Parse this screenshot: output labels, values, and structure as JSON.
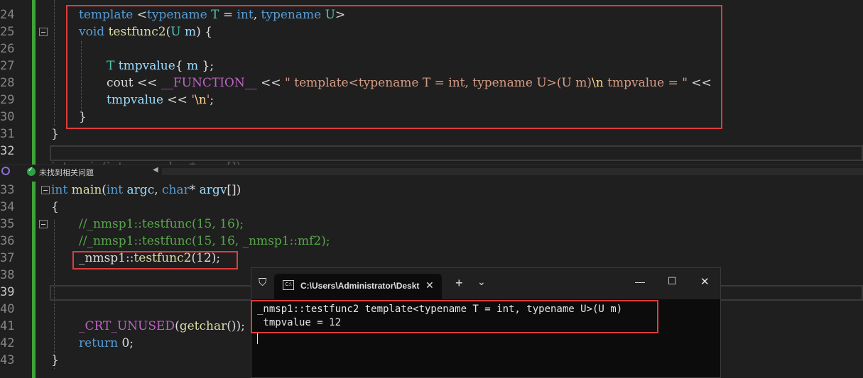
{
  "top_pane": {
    "line_numbers": [
      "24",
      "25",
      "26",
      "27",
      "28",
      "29",
      "30",
      "31",
      "32"
    ],
    "lines": [
      {
        "parts": [
          {
            "c": "kw",
            "t": "template"
          },
          {
            "c": "plain",
            "t": " <"
          },
          {
            "c": "kw",
            "t": "typename"
          },
          {
            "c": "plain",
            "t": " "
          },
          {
            "c": "ty",
            "t": "T"
          },
          {
            "c": "plain",
            "t": " = "
          },
          {
            "c": "kw",
            "t": "int"
          },
          {
            "c": "plain",
            "t": ", "
          },
          {
            "c": "kw",
            "t": "typename"
          },
          {
            "c": "plain",
            "t": " "
          },
          {
            "c": "ty",
            "t": "U"
          },
          {
            "c": "plain",
            "t": ">"
          }
        ]
      },
      {
        "parts": [
          {
            "c": "kw",
            "t": "void"
          },
          {
            "c": "plain",
            "t": " "
          },
          {
            "c": "fn",
            "t": "testfunc2"
          },
          {
            "c": "plain",
            "t": "("
          },
          {
            "c": "ty",
            "t": "U"
          },
          {
            "c": "plain",
            "t": " "
          },
          {
            "c": "par",
            "t": "m"
          },
          {
            "c": "plain",
            "t": ") {"
          }
        ]
      },
      {
        "parts": []
      },
      {
        "parts": [
          {
            "c": "ty",
            "t": "T"
          },
          {
            "c": "plain",
            "t": " "
          },
          {
            "c": "par",
            "t": "tmpvalue"
          },
          {
            "c": "plain",
            "t": "{ "
          },
          {
            "c": "par",
            "t": "m"
          },
          {
            "c": "plain",
            "t": " };"
          }
        ]
      },
      {
        "parts": [
          {
            "c": "plain",
            "t": "cout << "
          },
          {
            "c": "mac",
            "t": "__FUNCTION__"
          },
          {
            "c": "plain",
            "t": " << "
          },
          {
            "c": "str",
            "t": "\" template<typename T = int, typename U>(U m)"
          },
          {
            "c": "esc",
            "t": "\\n"
          },
          {
            "c": "str",
            "t": " tmpvalue = \""
          },
          {
            "c": "plain",
            "t": " <<"
          }
        ]
      },
      {
        "parts": [
          {
            "c": "par",
            "t": "tmpvalue"
          },
          {
            "c": "plain",
            "t": " << "
          },
          {
            "c": "str",
            "t": "'"
          },
          {
            "c": "esc",
            "t": "\\n"
          },
          {
            "c": "str",
            "t": "'"
          },
          {
            "c": "plain",
            "t": ";"
          }
        ]
      },
      {
        "parts": [
          {
            "c": "plain",
            "t": "}"
          }
        ]
      },
      {
        "parts": [
          {
            "c": "plain",
            "t": "}"
          }
        ]
      },
      {
        "parts": []
      }
    ],
    "partial_text": "int main(int argc, char* argv[])"
  },
  "status_strip": {
    "issues_text": "未找到相关问题"
  },
  "bottom_pane": {
    "line_numbers": [
      "33",
      "34",
      "35",
      "36",
      "37",
      "38",
      "39",
      "40",
      "41",
      "42",
      "43"
    ],
    "lines": [
      {
        "parts": [
          {
            "c": "kw",
            "t": "int"
          },
          {
            "c": "plain",
            "t": " "
          },
          {
            "c": "fn",
            "t": "main"
          },
          {
            "c": "plain",
            "t": "("
          },
          {
            "c": "kw",
            "t": "int"
          },
          {
            "c": "plain",
            "t": " "
          },
          {
            "c": "par",
            "t": "argc"
          },
          {
            "c": "plain",
            "t": ", "
          },
          {
            "c": "kw",
            "t": "char"
          },
          {
            "c": "plain",
            "t": "* "
          },
          {
            "c": "par",
            "t": "argv"
          },
          {
            "c": "plain",
            "t": "[])"
          }
        ]
      },
      {
        "parts": [
          {
            "c": "plain",
            "t": "{"
          }
        ]
      },
      {
        "parts": [
          {
            "c": "cm",
            "t": "//_nmsp1::testfunc(15, 16);"
          }
        ]
      },
      {
        "parts": [
          {
            "c": "cm",
            "t": "//_nmsp1::testfunc(15, 16, _nmsp1::mf2);"
          }
        ]
      },
      {
        "parts": [
          {
            "c": "plain",
            "t": "_nmsp1::"
          },
          {
            "c": "fn",
            "t": "testfunc2"
          },
          {
            "c": "plain",
            "t": "(12);"
          }
        ]
      },
      {
        "parts": []
      },
      {
        "parts": []
      },
      {
        "parts": []
      },
      {
        "parts": [
          {
            "c": "mac",
            "t": "_CRT_UNUSED"
          },
          {
            "c": "plain",
            "t": "("
          },
          {
            "c": "fn",
            "t": "getchar"
          },
          {
            "c": "plain",
            "t": "());"
          }
        ]
      },
      {
        "parts": [
          {
            "c": "kw",
            "t": "return"
          },
          {
            "c": "plain",
            "t": " 0;"
          }
        ]
      },
      {
        "parts": [
          {
            "c": "plain",
            "t": "}"
          }
        ]
      }
    ]
  },
  "terminal": {
    "tab_title": "C:\\Users\\Administrator\\Deskt",
    "new_tab_glyph": "+",
    "dropdown_glyph": "⌄",
    "minimize_glyph": "—",
    "maximize_glyph": "☐",
    "close_glyph": "✕",
    "tab_close_glyph": "✕",
    "output": [
      "_nmsp1::testfunc2 template<typename T = int, typename U>(U m)",
      " tmpvalue = 12"
    ]
  },
  "colors": {
    "editor_bg": "#1f1f1f",
    "highlight_box": "#e03c3c",
    "change_bar": "#3fa33a"
  }
}
